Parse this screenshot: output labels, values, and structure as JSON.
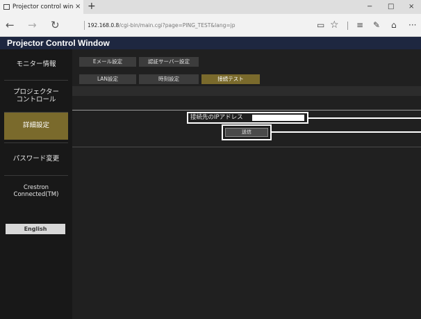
{
  "browser": {
    "tab_title": "Projector control windo",
    "tab_close": "×",
    "new_tab": "+",
    "url_host": "192.168.0.8",
    "url_path": "/cgi-bin/main.cgi?page=PING_TEST&lang=jp",
    "window_controls": {
      "minimize": "−",
      "maximize": "□",
      "close": "×"
    },
    "nav": {
      "back": "←",
      "forward": "→",
      "refresh": "↻"
    },
    "toolbar": {
      "reading_view": "▭",
      "favorite": "☆",
      "hub": "≡",
      "notes": "✎",
      "share": "⌂",
      "more": "···"
    }
  },
  "app": {
    "title": "Projector Control Window"
  },
  "sidebar": {
    "items": [
      {
        "label": "モニター情報"
      },
      {
        "label": "プロジェクター\nコントロール"
      },
      {
        "label": "詳細設定"
      },
      {
        "label": "パスワード変更"
      },
      {
        "label": "Crestron\nConnected(TM)"
      }
    ],
    "language_button": "English"
  },
  "main": {
    "tabs_row1": [
      {
        "label": "Eメール設定"
      },
      {
        "label": "認証サーバー設定"
      }
    ],
    "tabs_row2": [
      {
        "label": "LAN設定"
      },
      {
        "label": "時刻設定"
      },
      {
        "label": "接続テスト"
      }
    ],
    "ip_label": "接続先のIPアドレス",
    "ip_value": "",
    "send_label": "送信"
  }
}
